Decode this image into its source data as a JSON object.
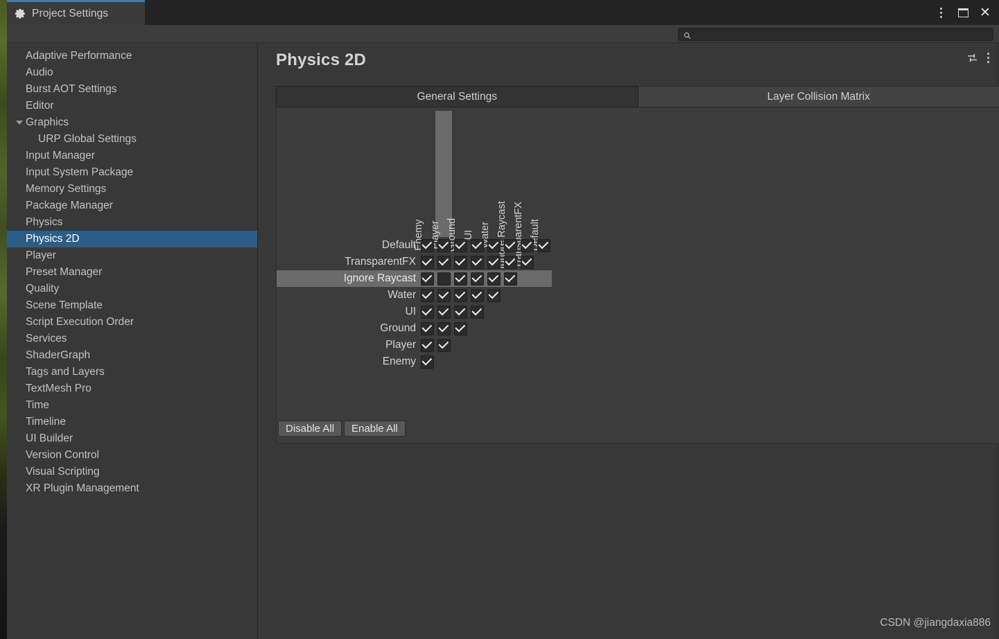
{
  "window": {
    "tab_title": "Project Settings",
    "tab_icon": "gear-icon",
    "controls": [
      {
        "name": "window-menu-button",
        "icon": "vertical-dots-icon"
      },
      {
        "name": "maximize-button",
        "icon": "maximize-square-icon"
      },
      {
        "name": "close-button",
        "icon": "close-x-icon",
        "glyph": "✕"
      }
    ],
    "accent_color": "#3d7db5"
  },
  "toolbar": {
    "search": {
      "icon": "search-icon",
      "value": "",
      "placeholder": ""
    }
  },
  "sidebar": {
    "items": [
      {
        "label": "Adaptive Performance",
        "selected": false,
        "child": false,
        "expander": false
      },
      {
        "label": "Audio",
        "selected": false,
        "child": false,
        "expander": false
      },
      {
        "label": "Burst AOT Settings",
        "selected": false,
        "child": false,
        "expander": false
      },
      {
        "label": "Editor",
        "selected": false,
        "child": false,
        "expander": false
      },
      {
        "label": "Graphics",
        "selected": false,
        "child": false,
        "expander": true
      },
      {
        "label": "URP Global Settings",
        "selected": false,
        "child": true,
        "expander": false
      },
      {
        "label": "Input Manager",
        "selected": false,
        "child": false,
        "expander": false
      },
      {
        "label": "Input System Package",
        "selected": false,
        "child": false,
        "expander": false
      },
      {
        "label": "Memory Settings",
        "selected": false,
        "child": false,
        "expander": false
      },
      {
        "label": "Package Manager",
        "selected": false,
        "child": false,
        "expander": false
      },
      {
        "label": "Physics",
        "selected": false,
        "child": false,
        "expander": false
      },
      {
        "label": "Physics 2D",
        "selected": true,
        "child": false,
        "expander": false
      },
      {
        "label": "Player",
        "selected": false,
        "child": false,
        "expander": false
      },
      {
        "label": "Preset Manager",
        "selected": false,
        "child": false,
        "expander": false
      },
      {
        "label": "Quality",
        "selected": false,
        "child": false,
        "expander": false
      },
      {
        "label": "Scene Template",
        "selected": false,
        "child": false,
        "expander": false
      },
      {
        "label": "Script Execution Order",
        "selected": false,
        "child": false,
        "expander": false
      },
      {
        "label": "Services",
        "selected": false,
        "child": false,
        "expander": false
      },
      {
        "label": "ShaderGraph",
        "selected": false,
        "child": false,
        "expander": false
      },
      {
        "label": "Tags and Layers",
        "selected": false,
        "child": false,
        "expander": false
      },
      {
        "label": "TextMesh Pro",
        "selected": false,
        "child": false,
        "expander": false
      },
      {
        "label": "Time",
        "selected": false,
        "child": false,
        "expander": false
      },
      {
        "label": "Timeline",
        "selected": false,
        "child": false,
        "expander": false
      },
      {
        "label": "UI Builder",
        "selected": false,
        "child": false,
        "expander": false
      },
      {
        "label": "Version Control",
        "selected": false,
        "child": false,
        "expander": false
      },
      {
        "label": "Visual Scripting",
        "selected": false,
        "child": false,
        "expander": false
      },
      {
        "label": "XR Plugin Management",
        "selected": false,
        "child": false,
        "expander": false
      }
    ],
    "selected_color": "#2c5d87"
  },
  "main": {
    "title": "Physics 2D",
    "header_icons": [
      {
        "name": "settings-sliders-icon"
      },
      {
        "name": "more-options-icon"
      }
    ],
    "tabs": [
      {
        "label": "General Settings",
        "state": "pressed"
      },
      {
        "label": "Layer Collision Matrix",
        "state": "active"
      }
    ]
  },
  "matrix": {
    "columns": [
      "Enemy",
      "Player",
      "Ground",
      "UI",
      "Water",
      "Ignore Raycast",
      "TransparentFX",
      "Default"
    ],
    "highlighted_column": "Player",
    "highlighted_row": "Ignore Raycast",
    "rows": [
      {
        "label": "Default",
        "checks": [
          true,
          true,
          true,
          true,
          true,
          true,
          true,
          true
        ]
      },
      {
        "label": "TransparentFX",
        "checks": [
          true,
          true,
          true,
          true,
          true,
          true,
          true
        ]
      },
      {
        "label": "Ignore Raycast",
        "checks": [
          true,
          false,
          true,
          true,
          true,
          true
        ]
      },
      {
        "label": "Water",
        "checks": [
          true,
          true,
          true,
          true,
          true
        ]
      },
      {
        "label": "UI",
        "checks": [
          true,
          true,
          true,
          true
        ]
      },
      {
        "label": "Ground",
        "checks": [
          true,
          true,
          true
        ]
      },
      {
        "label": "Player",
        "checks": [
          true,
          true
        ]
      },
      {
        "label": "Enemy",
        "checks": [
          true
        ]
      }
    ],
    "buttons": [
      {
        "label": "Disable All"
      },
      {
        "label": "Enable All"
      }
    ]
  },
  "watermark": {
    "text": "CSDN @jiangdaxia886"
  }
}
